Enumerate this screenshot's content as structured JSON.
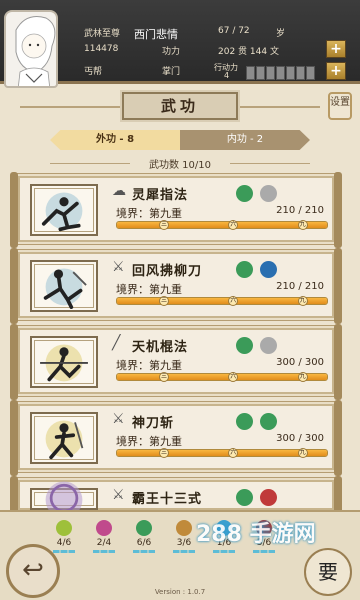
{
  "header": {
    "title_label": "武林至尊",
    "player_name": "西门悲情",
    "age_value": "67 / 72",
    "age_unit": "岁",
    "power_id": "114478",
    "power_label": "功力",
    "silver_value": "202 贯 144 文",
    "sect": "丐帮",
    "rank": "掌门",
    "action_label": "行动力",
    "action_value": "4"
  },
  "settings_label": "设置",
  "page_title": "武功",
  "tabs": [
    {
      "label": "外功 - 8",
      "active": true
    },
    {
      "label": "内功 - 2",
      "active": false
    }
  ],
  "skill_count": "武功数 10/10",
  "skills": [
    {
      "name": "灵犀指法",
      "realm": "境界：第九重",
      "value": "210 / 210",
      "level_fraction": 1.0,
      "badges": [
        {
          "color": "#3b9b59",
          "text": ""
        },
        {
          "color": "#aaaaaa",
          "text": ""
        }
      ]
    },
    {
      "name": "回风拂柳刀",
      "realm": "境界：第九重",
      "value": "210 / 210",
      "level_fraction": 1.0,
      "badges": [
        {
          "color": "#3b9b59",
          "text": ""
        },
        {
          "color": "#2a6fb0",
          "text": ""
        }
      ]
    },
    {
      "name": "天机棍法",
      "realm": "境界：第九重",
      "value": "300 / 300",
      "level_fraction": 1.0,
      "badges": [
        {
          "color": "#3b9b59",
          "text": ""
        },
        {
          "color": "#aaaaaa",
          "text": ""
        }
      ]
    },
    {
      "name": "神刀斩",
      "realm": "境界：第九重",
      "value": "300 / 300",
      "level_fraction": 1.0,
      "badges": [
        {
          "color": "#3b9b59",
          "text": ""
        },
        {
          "color": "#3b9b59",
          "text": ""
        }
      ]
    },
    {
      "name": "霸王十三式",
      "realm": "",
      "value": "",
      "level_fraction": 1.0,
      "badges": [
        {
          "color": "#3b9b59",
          "text": ""
        },
        {
          "color": "#c03a3a",
          "text": ""
        }
      ]
    }
  ],
  "bar_marks": [
    "三",
    "六",
    "九"
  ],
  "slots": [
    {
      "value": "4/6",
      "color": "#9ec03a"
    },
    {
      "value": "2/4",
      "color": "#c04a8c"
    },
    {
      "value": "6/6",
      "color": "#3b9b59"
    },
    {
      "value": "3/6",
      "color": "#c08a3a"
    },
    {
      "value": "1/6",
      "color": "#3aa0d0"
    },
    {
      "value": "3/6",
      "color": "#9e3a3a"
    }
  ],
  "watermark": "288 手游网",
  "version": "Version : 1.0.7",
  "back_label": "↩",
  "corner_char": "要"
}
